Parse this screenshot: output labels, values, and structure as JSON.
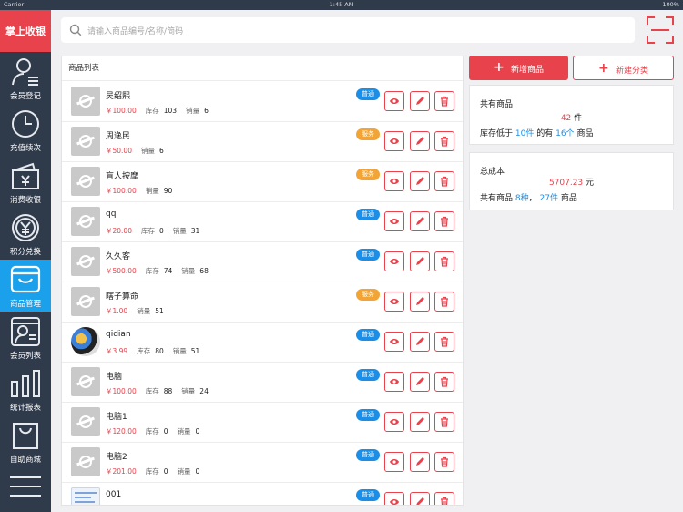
{
  "status_bar": {
    "carrier": "Carrier",
    "time": "1:45 AM",
    "battery": "100%"
  },
  "app": {
    "brand": "掌上收银"
  },
  "sidebar": {
    "items": [
      {
        "label": "会员登记",
        "icon": "member-register-icon",
        "active": false
      },
      {
        "label": "充值续次",
        "icon": "recharge-clock-icon",
        "active": false
      },
      {
        "label": "消费收银",
        "icon": "cashier-wallet-icon",
        "active": false
      },
      {
        "label": "积分兑换",
        "icon": "points-yen-icon",
        "active": false
      },
      {
        "label": "商品管理",
        "icon": "goods-basket-icon",
        "active": true
      },
      {
        "label": "会员列表",
        "icon": "member-list-icon",
        "active": false
      },
      {
        "label": "统计报表",
        "icon": "report-chart-icon",
        "active": false
      },
      {
        "label": "自助商城",
        "icon": "shop-bag-icon",
        "active": false
      }
    ],
    "menu_icon": "hamburger-menu-icon"
  },
  "search": {
    "placeholder": "请输入商品编号/名称/简码",
    "icon": "search-icon",
    "scan_icon": "scan-icon"
  },
  "product_list": {
    "title": "商品列表",
    "rows": [
      {
        "name": "吴绍熙",
        "price": "￥100.00",
        "stock_label": "库存",
        "stock": "103",
        "sales_label": "销量",
        "sales": "6",
        "badge": "普通",
        "type": "normal",
        "thumb": "placeholder"
      },
      {
        "name": "周逸民",
        "price": "￥50.00",
        "stock_label": "",
        "stock": "",
        "sales_label": "销量",
        "sales": "6",
        "badge": "服务",
        "type": "service",
        "thumb": "placeholder"
      },
      {
        "name": "盲人按摩",
        "price": "￥100.00",
        "stock_label": "",
        "stock": "",
        "sales_label": "销量",
        "sales": "90",
        "badge": "服务",
        "type": "service",
        "thumb": "placeholder"
      },
      {
        "name": "qq",
        "price": "￥20.00",
        "stock_label": "库存",
        "stock": "0",
        "sales_label": "销量",
        "sales": "31",
        "badge": "普通",
        "type": "normal",
        "thumb": "placeholder"
      },
      {
        "name": "久久客",
        "price": "￥500.00",
        "stock_label": "库存",
        "stock": "74",
        "sales_label": "销量",
        "sales": "68",
        "badge": "普通",
        "type": "normal",
        "thumb": "placeholder"
      },
      {
        "name": "瞎子算命",
        "price": "￥1.00",
        "stock_label": "",
        "stock": "",
        "sales_label": "销量",
        "sales": "51",
        "badge": "服务",
        "type": "service",
        "thumb": "placeholder"
      },
      {
        "name": "qidian",
        "price": "￥3.99",
        "stock_label": "库存",
        "stock": "80",
        "sales_label": "销量",
        "sales": "51",
        "badge": "普通",
        "type": "normal",
        "thumb": "photo"
      },
      {
        "name": "电脑",
        "price": "￥100.00",
        "stock_label": "库存",
        "stock": "88",
        "sales_label": "销量",
        "sales": "24",
        "badge": "普通",
        "type": "normal",
        "thumb": "placeholder"
      },
      {
        "name": "电脑1",
        "price": "￥120.00",
        "stock_label": "库存",
        "stock": "0",
        "sales_label": "销量",
        "sales": "0",
        "badge": "普通",
        "type": "normal",
        "thumb": "placeholder"
      },
      {
        "name": "电脑2",
        "price": "￥201.00",
        "stock_label": "库存",
        "stock": "0",
        "sales_label": "销量",
        "sales": "0",
        "badge": "普通",
        "type": "normal",
        "thumb": "placeholder"
      },
      {
        "name": "001",
        "price": "",
        "stock_label": "",
        "stock": "",
        "sales_label": "",
        "sales": "",
        "badge": "普通",
        "type": "normal",
        "thumb": "screen"
      }
    ],
    "row_action_icons": [
      "view-eye-icon",
      "edit-pencil-icon",
      "delete-trash-icon"
    ]
  },
  "actions": {
    "add_goods": "新增商品",
    "new_category": "新建分类"
  },
  "summary": {
    "total_title": "共有商品",
    "total_count": "42",
    "total_unit": "件",
    "low_stock_prefix": "库存低于",
    "low_stock_threshold": "10件",
    "low_stock_mid": "的有",
    "low_stock_count": "16个",
    "low_stock_suffix": "商品",
    "cost_title": "总成本",
    "cost_value": "5707.23",
    "cost_unit": "元",
    "kinds_prefix": "共有商品",
    "kinds_count": "8种",
    "kinds_sep": "，",
    "items_count": "27件",
    "kinds_suffix": "商品"
  },
  "colors": {
    "accent_red": "#e8424c",
    "accent_blue": "#1b8fe8",
    "sidebar_bg": "#2f3a4b",
    "sidebar_active": "#1ba0ec",
    "service_orange": "#f2a536"
  }
}
